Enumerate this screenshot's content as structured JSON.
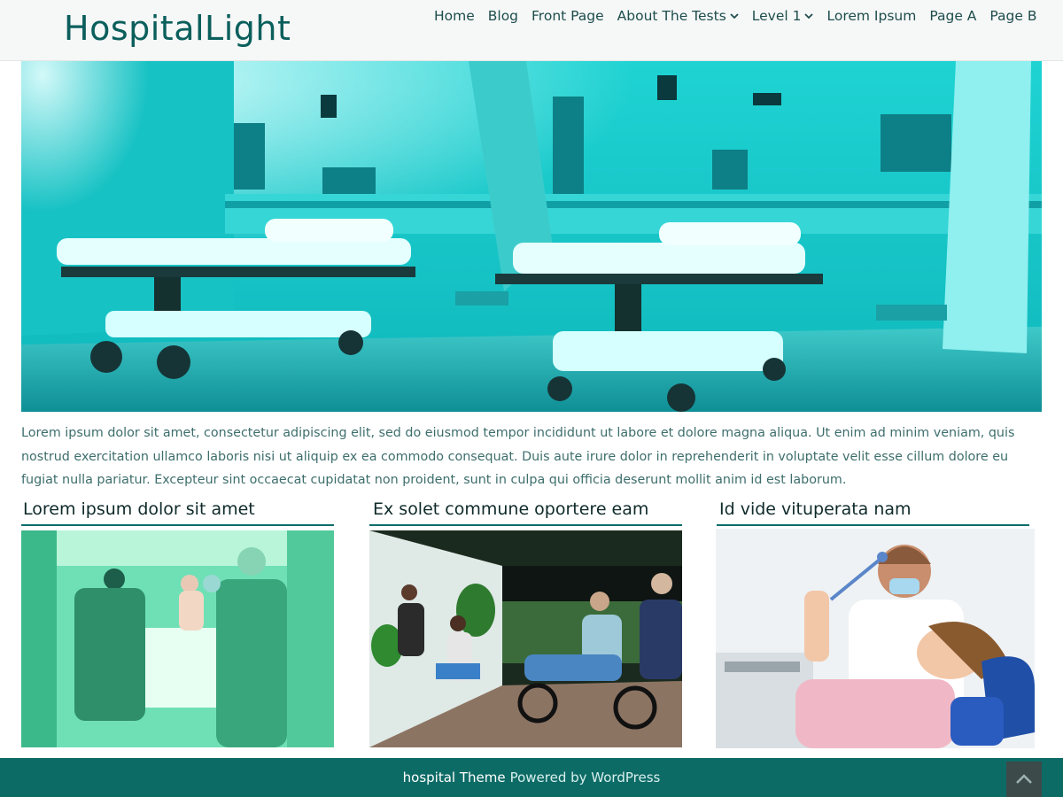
{
  "site": {
    "title": "HospitalLight"
  },
  "nav": {
    "items": [
      {
        "label": "Home"
      },
      {
        "label": "Blog"
      },
      {
        "label": "Front Page"
      },
      {
        "label": "About The Tests",
        "has_dropdown": true
      },
      {
        "label": "Level 1",
        "has_dropdown": true
      },
      {
        "label": "Lorem Ipsum"
      },
      {
        "label": "Page A"
      },
      {
        "label": "Page B"
      }
    ]
  },
  "intro": {
    "text": "Lorem ipsum dolor sit amet, consectetur adipiscing elit, sed do eiusmod tempor incididunt ut labore et dolore magna aliqua. Ut enim ad minim veniam, quis nostrud exercitation ullamco laboris nisi ut aliquip ex ea commodo consequat. Duis aute irure dolor in reprehenderit in voluptate velit esse cillum dolore eu fugiat nulla pariatur. Excepteur sint occaecat cupidatat non proident, sunt in culpa qui officia deserunt mollit anim id est laborum."
  },
  "columns": [
    {
      "title": "Lorem ipsum dolor sit amet"
    },
    {
      "title": "Ex solet commune oportere eam"
    },
    {
      "title": "Id vide vituperata nam"
    }
  ],
  "footer": {
    "theme_link": "hospital Theme",
    "powered_by": "Powered by WordPress"
  },
  "icons": {
    "dropdown": "chevron-down-icon",
    "scroll_top": "chevron-up-icon"
  },
  "colors": {
    "brand": "#0b5f5c",
    "footer_bg": "#0d6b66",
    "accent_rule": "#0f6d6a"
  }
}
